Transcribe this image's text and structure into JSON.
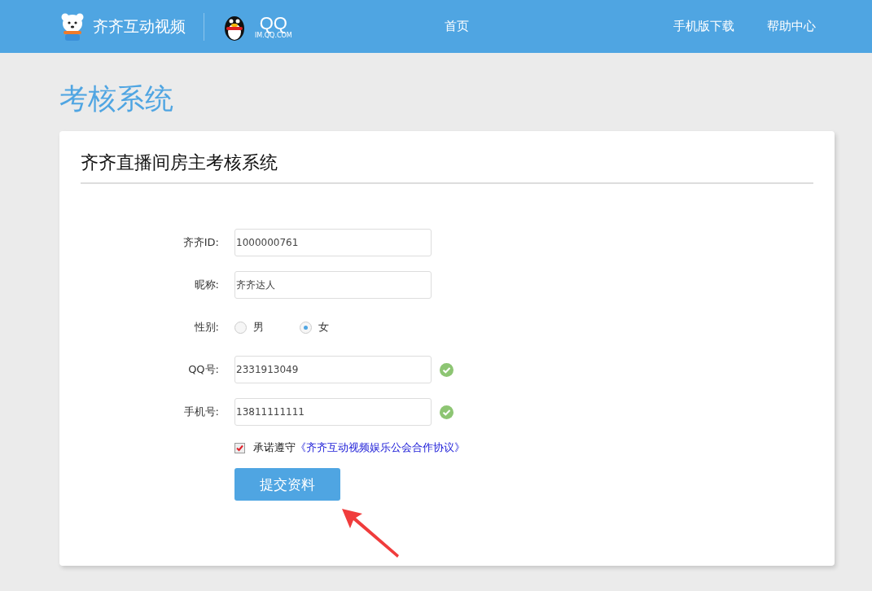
{
  "header": {
    "brand": "齐齐互动视频",
    "partner_logo": {
      "title": "QQ",
      "subtitle": "IM.QQ.COM"
    },
    "nav_center": [
      {
        "label": "首页"
      }
    ],
    "nav_right": [
      {
        "label": "手机版下载"
      },
      {
        "label": "帮助中心"
      }
    ]
  },
  "page_title": "考核系统",
  "card": {
    "title": "齐齐直播间房主考核系统",
    "fields": [
      {
        "kind": "text",
        "label": "齐齐ID:",
        "value": "1000000761",
        "valid": false
      },
      {
        "kind": "text",
        "label": "昵称:",
        "value": "齐齐达人",
        "valid": false
      },
      {
        "kind": "radio",
        "label": "性别:",
        "options": [
          {
            "label": "男",
            "selected": false
          },
          {
            "label": "女",
            "selected": true
          }
        ]
      },
      {
        "kind": "text",
        "label": "QQ号:",
        "value": "2331913049",
        "valid": true
      },
      {
        "kind": "text",
        "label": "手机号:",
        "value": "13811111111",
        "valid": true
      }
    ],
    "agreement": {
      "checked": true,
      "text": "承诺遵守",
      "link": "《齐齐互动视频娱乐公会合作协议》"
    },
    "submit": "提交资料"
  }
}
